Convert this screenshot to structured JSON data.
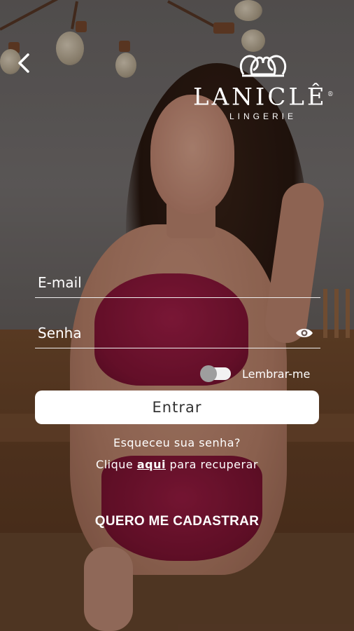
{
  "header": {
    "back_icon": "chevron-left-icon",
    "logo": {
      "name": "LANICLÊ",
      "subtitle": "LINGERIE",
      "registered": "®"
    }
  },
  "form": {
    "email": {
      "placeholder": "E-mail",
      "value": ""
    },
    "password": {
      "placeholder": "Senha",
      "value": "",
      "visibility_icon": "eye-icon"
    },
    "remember": {
      "label": "Lembrar-me",
      "on": false
    },
    "submit_label": "Entrar"
  },
  "recovery": {
    "question": "Esqueceu sua senha?",
    "line_prefix": "Clique ",
    "link": "aqui",
    "line_suffix": " para recuperar"
  },
  "register_label": "QUERO ME CADASTRAR",
  "colors": {
    "button_bg": "#ffffff",
    "button_text": "#333333",
    "text": "#ffffff",
    "toggle_knob": "#9e9e9e"
  }
}
